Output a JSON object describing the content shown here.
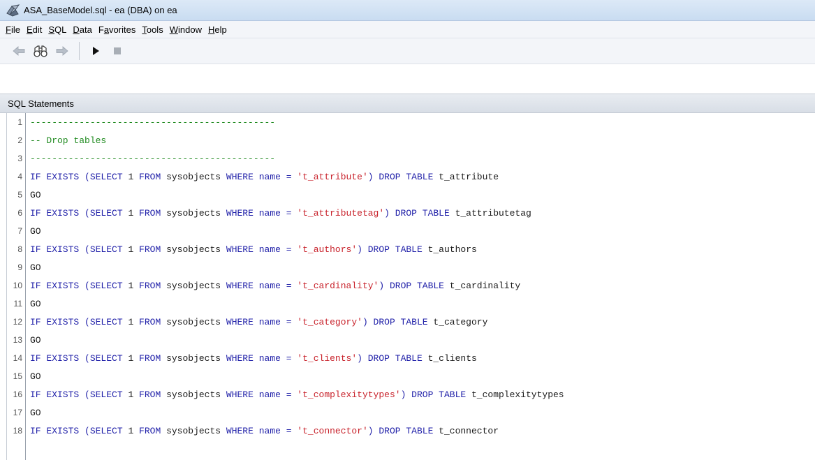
{
  "window": {
    "title": "ASA_BaseModel.sql - ea (DBA) on ea"
  },
  "menu": [
    {
      "label": "File",
      "acc": "F",
      "rest": "ile"
    },
    {
      "label": "Edit",
      "acc": "E",
      "rest": "dit"
    },
    {
      "label": "SQL",
      "acc": "S",
      "rest": "QL"
    },
    {
      "label": "Data",
      "acc": "D",
      "rest": "ata"
    },
    {
      "label": "Favorites",
      "acc": "a",
      "pre": "F",
      "rest": "vorites"
    },
    {
      "label": "Tools",
      "acc": "T",
      "rest": "ools"
    },
    {
      "label": "Window",
      "acc": "W",
      "rest": "indow"
    },
    {
      "label": "Help",
      "acc": "H",
      "rest": "elp"
    }
  ],
  "toolbar": {
    "icons": [
      "back-arrow-icon",
      "binoculars-icon",
      "forward-arrow-icon",
      "execute-icon",
      "stop-icon"
    ]
  },
  "section": {
    "title": "SQL Statements"
  },
  "editor": {
    "lines": [
      {
        "n": "1",
        "parts": [
          {
            "t": "cm",
            "v": "---------------------------------------------"
          }
        ]
      },
      {
        "n": "2",
        "parts": [
          {
            "t": "cm",
            "v": "-- Drop tables"
          }
        ]
      },
      {
        "n": "3",
        "parts": [
          {
            "t": "cm",
            "v": "---------------------------------------------"
          }
        ]
      },
      {
        "n": "4",
        "parts": [
          {
            "t": "kw",
            "v": "IF EXISTS ("
          },
          {
            "t": "kw",
            "v": "SELECT"
          },
          {
            "t": "tx",
            "v": " 1 "
          },
          {
            "t": "kw",
            "v": "FROM"
          },
          {
            "t": "tx",
            "v": " sysobjects "
          },
          {
            "t": "kw",
            "v": "WHERE"
          },
          {
            "t": "kw",
            "v": " name = "
          },
          {
            "t": "str",
            "v": "'t_attribute'"
          },
          {
            "t": "kw",
            "v": ") DROP TABLE"
          },
          {
            "t": "tx",
            "v": " t_attribute"
          }
        ]
      },
      {
        "n": "5",
        "parts": [
          {
            "t": "tx",
            "v": "GO"
          }
        ]
      },
      {
        "n": "6",
        "parts": [
          {
            "t": "kw",
            "v": "IF EXISTS ("
          },
          {
            "t": "kw",
            "v": "SELECT"
          },
          {
            "t": "tx",
            "v": " 1 "
          },
          {
            "t": "kw",
            "v": "FROM"
          },
          {
            "t": "tx",
            "v": " sysobjects "
          },
          {
            "t": "kw",
            "v": "WHERE"
          },
          {
            "t": "kw",
            "v": " name = "
          },
          {
            "t": "str",
            "v": "'t_attributetag'"
          },
          {
            "t": "kw",
            "v": ") DROP TABLE"
          },
          {
            "t": "tx",
            "v": " t_attributetag"
          }
        ]
      },
      {
        "n": "7",
        "parts": [
          {
            "t": "tx",
            "v": "GO"
          }
        ]
      },
      {
        "n": "8",
        "parts": [
          {
            "t": "kw",
            "v": "IF EXISTS ("
          },
          {
            "t": "kw",
            "v": "SELECT"
          },
          {
            "t": "tx",
            "v": " 1 "
          },
          {
            "t": "kw",
            "v": "FROM"
          },
          {
            "t": "tx",
            "v": " sysobjects "
          },
          {
            "t": "kw",
            "v": "WHERE"
          },
          {
            "t": "kw",
            "v": " name = "
          },
          {
            "t": "str",
            "v": "'t_authors'"
          },
          {
            "t": "kw",
            "v": ") DROP TABLE"
          },
          {
            "t": "tx",
            "v": " t_authors"
          }
        ]
      },
      {
        "n": "9",
        "parts": [
          {
            "t": "tx",
            "v": "GO"
          }
        ]
      },
      {
        "n": "10",
        "parts": [
          {
            "t": "kw",
            "v": "IF EXISTS ("
          },
          {
            "t": "kw",
            "v": "SELECT"
          },
          {
            "t": "tx",
            "v": " 1 "
          },
          {
            "t": "kw",
            "v": "FROM"
          },
          {
            "t": "tx",
            "v": " sysobjects "
          },
          {
            "t": "kw",
            "v": "WHERE"
          },
          {
            "t": "kw",
            "v": " name = "
          },
          {
            "t": "str",
            "v": "'t_cardinality'"
          },
          {
            "t": "kw",
            "v": ") DROP TABLE"
          },
          {
            "t": "tx",
            "v": " t_cardinality"
          }
        ]
      },
      {
        "n": "11",
        "parts": [
          {
            "t": "tx",
            "v": "GO"
          }
        ]
      },
      {
        "n": "12",
        "parts": [
          {
            "t": "kw",
            "v": "IF EXISTS ("
          },
          {
            "t": "kw",
            "v": "SELECT"
          },
          {
            "t": "tx",
            "v": " 1 "
          },
          {
            "t": "kw",
            "v": "FROM"
          },
          {
            "t": "tx",
            "v": " sysobjects "
          },
          {
            "t": "kw",
            "v": "WHERE"
          },
          {
            "t": "kw",
            "v": " name = "
          },
          {
            "t": "str",
            "v": "'t_category'"
          },
          {
            "t": "kw",
            "v": ") DROP TABLE"
          },
          {
            "t": "tx",
            "v": " t_category"
          }
        ]
      },
      {
        "n": "13",
        "parts": [
          {
            "t": "tx",
            "v": "GO"
          }
        ]
      },
      {
        "n": "14",
        "parts": [
          {
            "t": "kw",
            "v": "IF EXISTS ("
          },
          {
            "t": "kw",
            "v": "SELECT"
          },
          {
            "t": "tx",
            "v": " 1 "
          },
          {
            "t": "kw",
            "v": "FROM"
          },
          {
            "t": "tx",
            "v": " sysobjects "
          },
          {
            "t": "kw",
            "v": "WHERE"
          },
          {
            "t": "kw",
            "v": " name = "
          },
          {
            "t": "str",
            "v": "'t_clients'"
          },
          {
            "t": "kw",
            "v": ") DROP TABLE"
          },
          {
            "t": "tx",
            "v": " t_clients"
          }
        ]
      },
      {
        "n": "15",
        "parts": [
          {
            "t": "tx",
            "v": "GO"
          }
        ]
      },
      {
        "n": "16",
        "parts": [
          {
            "t": "kw",
            "v": "IF EXISTS ("
          },
          {
            "t": "kw",
            "v": "SELECT"
          },
          {
            "t": "tx",
            "v": " 1 "
          },
          {
            "t": "kw",
            "v": "FROM"
          },
          {
            "t": "tx",
            "v": " sysobjects "
          },
          {
            "t": "kw",
            "v": "WHERE"
          },
          {
            "t": "kw",
            "v": " name = "
          },
          {
            "t": "str",
            "v": "'t_complexitytypes'"
          },
          {
            "t": "kw",
            "v": ") DROP TABLE"
          },
          {
            "t": "tx",
            "v": " t_complexitytypes"
          }
        ]
      },
      {
        "n": "17",
        "parts": [
          {
            "t": "tx",
            "v": "GO"
          }
        ]
      },
      {
        "n": "18",
        "parts": [
          {
            "t": "kw",
            "v": "IF EXISTS ("
          },
          {
            "t": "kw",
            "v": "SELECT"
          },
          {
            "t": "tx",
            "v": " 1 "
          },
          {
            "t": "kw",
            "v": "FROM"
          },
          {
            "t": "tx",
            "v": " sysobjects "
          },
          {
            "t": "kw",
            "v": "WHERE"
          },
          {
            "t": "kw",
            "v": " name = "
          },
          {
            "t": "str",
            "v": "'t_connector'"
          },
          {
            "t": "kw",
            "v": ") DROP TABLE"
          },
          {
            "t": "tx",
            "v": " t_connector"
          }
        ]
      }
    ]
  }
}
